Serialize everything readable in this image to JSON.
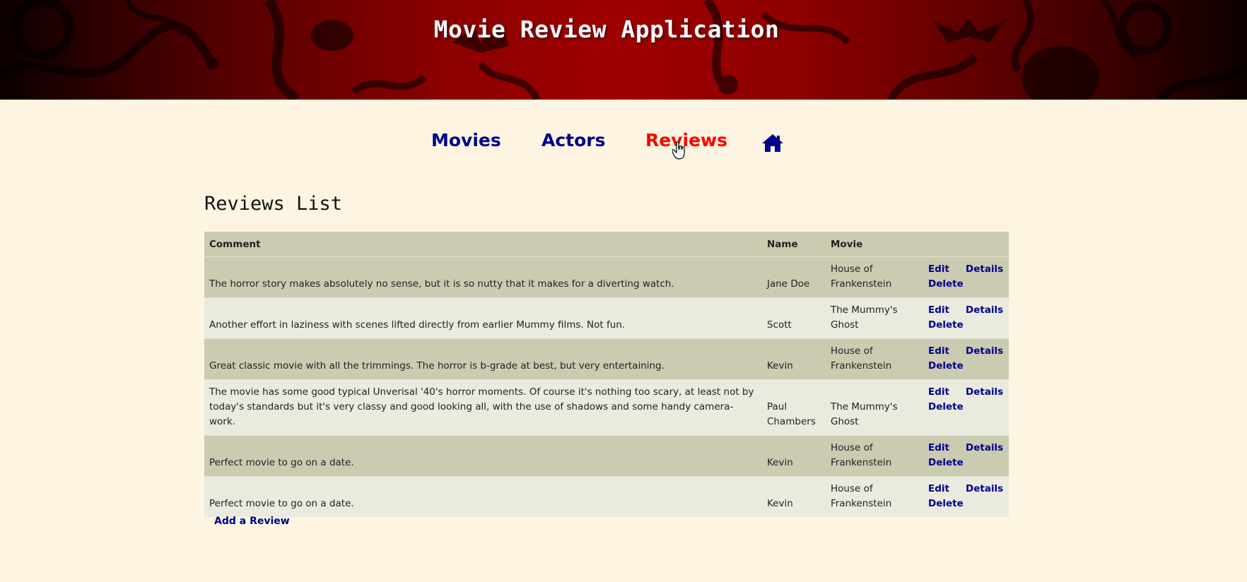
{
  "header": {
    "title": "Movie Review Application"
  },
  "nav": {
    "items": [
      {
        "label": "Movies",
        "active": false
      },
      {
        "label": "Actors",
        "active": false
      },
      {
        "label": "Reviews",
        "active": true
      }
    ],
    "home_icon": "home-icon"
  },
  "page": {
    "heading": "Reviews List"
  },
  "table": {
    "headers": {
      "comment": "Comment",
      "name": "Name",
      "movie": "Movie"
    },
    "action_labels": {
      "edit": "Edit",
      "details": "Details",
      "delete": "Delete"
    },
    "rows": [
      {
        "comment": "The horror story makes absolutely no sense, but it is so nutty that it makes for a diverting watch.",
        "name": "Jane Doe",
        "movie": "House of Frankenstein"
      },
      {
        "comment": "Another effort in laziness with scenes lifted directly from earlier Mummy films. Not fun.",
        "name": "Scott",
        "movie": "The Mummy's Ghost"
      },
      {
        "comment": "Great classic movie with all the trimmings. The horror is b-grade at best, but very entertaining.",
        "name": "Kevin",
        "movie": "House of Frankenstein"
      },
      {
        "comment": "The movie has some good typical Unverisal '40's horror moments. Of course it's nothing too scary, at least not by today's standards but it's very classy and good looking all, with the use of shadows and some handy camera-work.",
        "name": "Paul Chambers",
        "movie": "The Mummy's Ghost"
      },
      {
        "comment": "Perfect movie to go on a date.",
        "name": "Kevin",
        "movie": "House of Frankenstein"
      },
      {
        "comment": "Perfect movie to go on a date.",
        "name": "Kevin",
        "movie": "House of Frankenstein"
      }
    ]
  },
  "add_link": "Add a Review",
  "colors": {
    "link": "#00008b",
    "active": "#ff0000",
    "page_bg": "#fdf5e2",
    "row_dark": "#cbcbb1",
    "row_light": "#eaeadf"
  }
}
